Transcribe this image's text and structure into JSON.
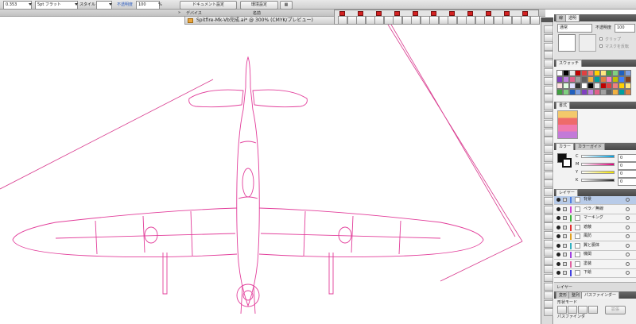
{
  "control_bar": {
    "stroke_value": "0.353",
    "stroke_profile": "5pt フラット",
    "style_label": "スタイル",
    "opacity_label": "不透明度",
    "opacity_value": "100",
    "opacity_unit": "%",
    "document_setup_button": "ドキュメント設定",
    "preferences_button": "環境設定"
  },
  "second_bar": {
    "device_label": "デバイス",
    "name_label": "名前"
  },
  "document": {
    "tab_title": "Spitfire-Mk-Vb完成.ai* @ 300% (CMYK/プレビュー)"
  },
  "panels": {
    "top_tabs": [
      "線",
      "透明"
    ],
    "blend_mode": "通常",
    "opacity_label": "不透明度",
    "opacity_value": "100",
    "clip_label": "クリップ",
    "invert_mask_label": "マスクを反転",
    "swatches_tab": "スウォッチ",
    "brushes_tab": "書式",
    "color_tabs": [
      "カラー",
      "カラーガイド"
    ],
    "color_channels": [
      {
        "label": "C",
        "value": "0",
        "color": "#00a0e0"
      },
      {
        "label": "M",
        "value": "0",
        "color": "#e0007a"
      },
      {
        "label": "Y",
        "value": "0",
        "color": "#f0e000"
      },
      {
        "label": "K",
        "value": "0",
        "color": "#222222"
      }
    ],
    "layers_tab": "レイヤー",
    "layers": [
      {
        "name": "背景",
        "color": "#4f7fe0",
        "selected": true
      },
      {
        "name": "ペラ／無線",
        "color": "#d040d0",
        "selected": false
      },
      {
        "name": "マーキング",
        "color": "#3ab23a",
        "selected": false
      },
      {
        "name": "遮蔽",
        "color": "#e03030",
        "selected": false
      },
      {
        "name": "風防",
        "color": "#e0a020",
        "selected": false
      },
      {
        "name": "翼と胴体",
        "color": "#30b0c0",
        "selected": false
      },
      {
        "name": "機関",
        "color": "#a040e0",
        "selected": false
      },
      {
        "name": "塗装",
        "color": "#e060a0",
        "selected": false
      },
      {
        "name": "下絵",
        "color": "#4040e0",
        "selected": false
      }
    ],
    "layers_footer": "レイヤー",
    "bottom_tabs": [
      "変形",
      "整列",
      "パスファインダー"
    ],
    "shape_mode_label": "形状モード",
    "pathfinder_label": "パスファインダ",
    "expand_button": "拡張"
  },
  "colors": {
    "artboard_line": "#d83a8e",
    "aircraft_line": "#e23d9a"
  }
}
